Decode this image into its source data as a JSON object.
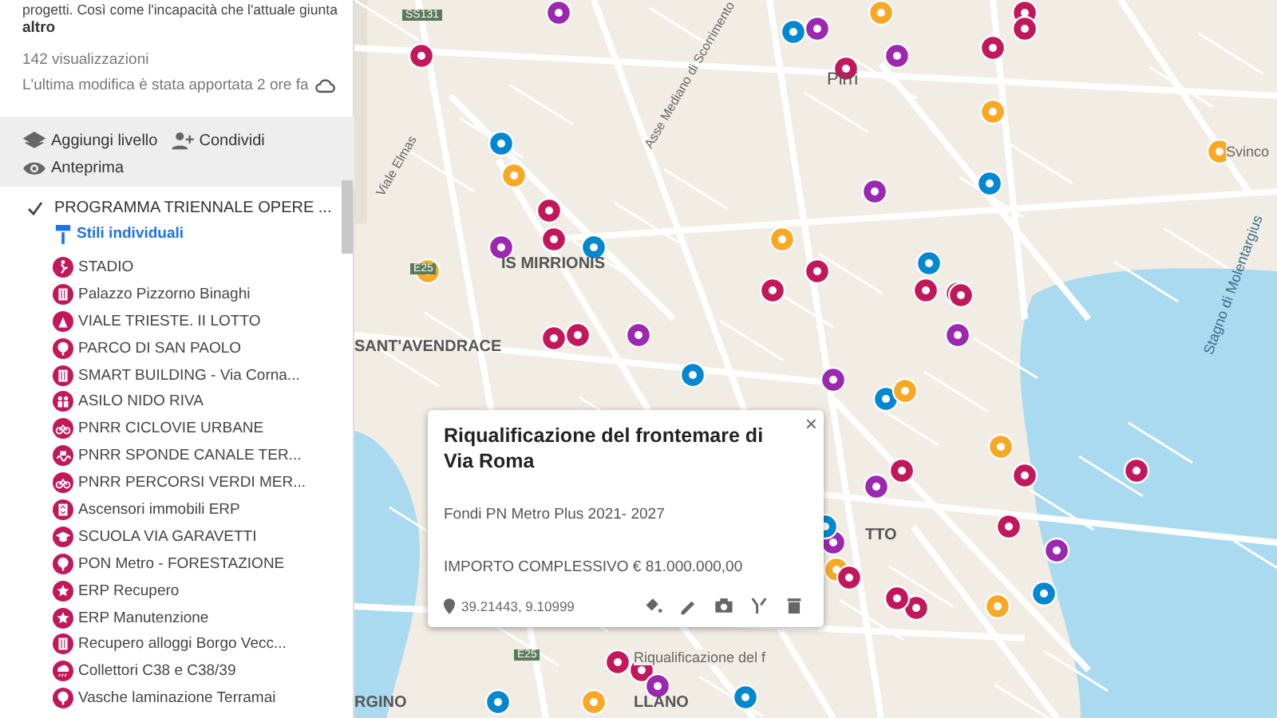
{
  "panel": {
    "description": "progetti. Così come l'incapacità che l'attuale giunta",
    "more_link": "altro",
    "views": "142 visualizzazioni",
    "last_modified": "L'ultima modifica è stata apportata 2 ore fa",
    "actions": [
      {
        "label": "Aggiungi livello",
        "kind": "layers"
      },
      {
        "label": "Condividi",
        "kind": "share"
      },
      {
        "label": "Anteprima",
        "kind": "preview"
      }
    ]
  },
  "layer": {
    "title": "PROGRAMMA TRIENNALE OPERE ...",
    "checked": true,
    "style_link": "Stili individuali",
    "items": [
      {
        "label": "STADIO",
        "kind": "person"
      },
      {
        "label": "Palazzo Pizzorno Binaghi",
        "kind": "building"
      },
      {
        "label": "VIALE TRIESTE. II LOTTO",
        "kind": "worker"
      },
      {
        "label": "PARCO DI SAN PAOLO",
        "kind": "tree"
      },
      {
        "label": "SMART BUILDING - Via Corna...",
        "kind": "building"
      },
      {
        "label": "ASILO NIDO RIVA",
        "kind": "family"
      },
      {
        "label": "PNRR CICLOVIE URBANE",
        "kind": "bike"
      },
      {
        "label": "PNRR SPONDE CANALE TER...",
        "kind": "wave"
      },
      {
        "label": "PNRR PERCORSI VERDI MER...",
        "kind": "bike"
      },
      {
        "label": "Ascensori immobili ERP",
        "kind": "elevator"
      },
      {
        "label": "SCUOLA VIA GARAVETTI",
        "kind": "school"
      },
      {
        "label": "PON Metro - FORESTAZIONE",
        "kind": "tree"
      },
      {
        "label": "ERP Recupero",
        "kind": "star"
      },
      {
        "label": "ERP Manutenzione",
        "kind": "star"
      },
      {
        "label": "Recupero alloggi Borgo Vecc...",
        "kind": "building"
      },
      {
        "label": "Collettori C38 e C38/39",
        "kind": "rain"
      },
      {
        "label": "Vasche laminazione Terramai",
        "kind": "tree"
      }
    ]
  },
  "map": {
    "labels": [
      {
        "text": "SS131",
        "kind": "shield"
      },
      {
        "text": "Pirri",
        "kind": "area"
      },
      {
        "text": "Svinco",
        "kind": "place"
      },
      {
        "text": "Asse Mediano di Scorrimento",
        "kind": "street"
      },
      {
        "text": "Viale Elmas",
        "kind": "street"
      },
      {
        "text": "IS MIRRIONIS",
        "kind": "district"
      },
      {
        "text": "E25",
        "kind": "shield"
      },
      {
        "text": "SANT'AVENDRACE",
        "kind": "district"
      },
      {
        "text": "Stagno di Molentargius",
        "kind": "water"
      },
      {
        "text": "TTO",
        "kind": "district"
      },
      {
        "text": "E25",
        "kind": "shield"
      },
      {
        "text": "Riqualificazione del f",
        "kind": "place"
      },
      {
        "text": "RGINO",
        "kind": "district"
      },
      {
        "text": "LLANO",
        "kind": "district"
      }
    ]
  },
  "popup": {
    "title": "Riqualificazione del frontemare di Via Roma",
    "lines": [
      "Fondi PN Metro Plus 2021- 2027",
      "IMPORTO COMPLESSIVO € 81.000.000,00"
    ],
    "coordinates": "39.21443, 9.10999",
    "close": "×"
  }
}
